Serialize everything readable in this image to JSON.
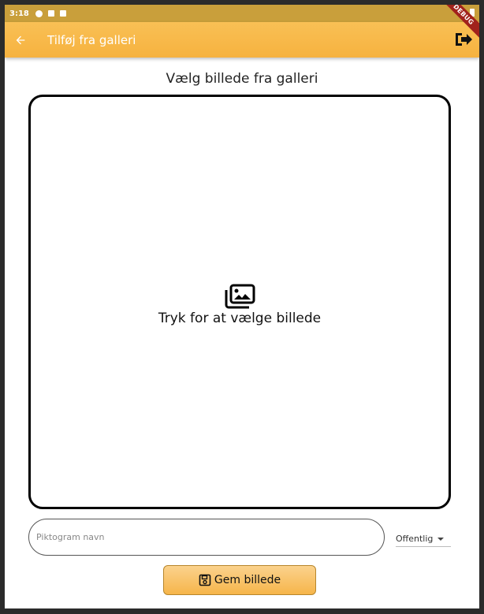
{
  "status_bar": {
    "time": "3:18",
    "left_icons": [
      "gear-icon",
      "a-icon",
      "sd-card-icon"
    ],
    "right_icons": [
      "wifi-icon",
      "battery-icon"
    ],
    "debug_label": "DEBUG"
  },
  "app_bar": {
    "back_icon": "arrow-back-icon",
    "title": "Tilføj fra galleri",
    "logout_icon": "sign-out-icon",
    "background": "#f7b445"
  },
  "page": {
    "heading": "Vælg billede fra galleri"
  },
  "picker": {
    "icon": "photo-library-icon",
    "label": "Tryk for at vælge billede"
  },
  "form": {
    "name_placeholder": "Piktogram navn",
    "visibility_value": "Offentlig",
    "save_label": "Gem billede",
    "save_icon": "save-icon"
  },
  "colors": {
    "accent": "#f7b445",
    "status_bar": "#c99f3b"
  }
}
